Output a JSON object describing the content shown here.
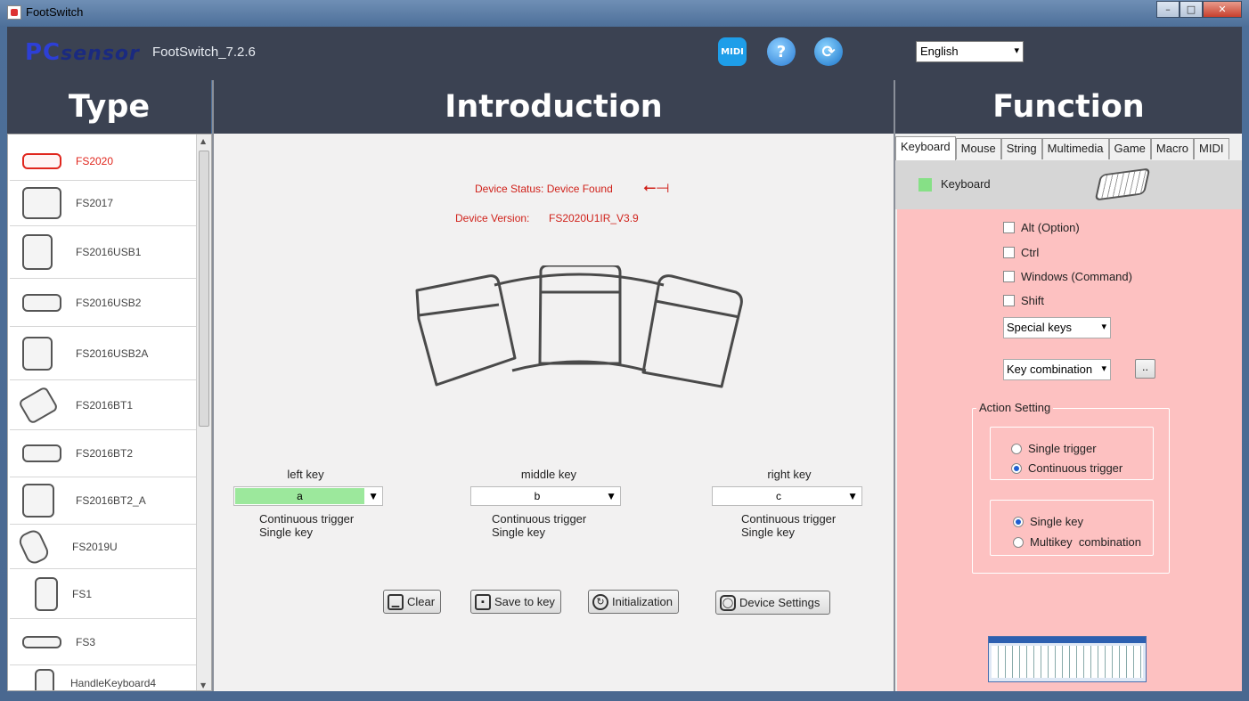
{
  "window": {
    "title": "FootSwitch",
    "controls": [
      "–",
      "□",
      "✕"
    ]
  },
  "header": {
    "logo_main": "PC",
    "logo_sub": "sensor",
    "version": "FootSwitch_7.2.6",
    "midi_label": "MIDI",
    "help_label": "?",
    "refresh_label": "⟳",
    "language": "English"
  },
  "columns": {
    "type": "Type",
    "introduction": "Introduction",
    "function": "Function"
  },
  "types": [
    {
      "label": "FS2020",
      "icon": "fs2020-icon",
      "selected": true
    },
    {
      "label": "FS2017",
      "icon": "fs2017-icon"
    },
    {
      "label": "FS2016USB1",
      "icon": "fs2016usb1-icon"
    },
    {
      "label": "FS2016USB2",
      "icon": "fs2016usb2-icon"
    },
    {
      "label": "FS2016USB2A",
      "icon": "fs2016usb2a-icon"
    },
    {
      "label": "FS2016BT1",
      "icon": "fs2016bt1-icon"
    },
    {
      "label": "FS2016BT2",
      "icon": "fs2016bt2-icon"
    },
    {
      "label": "FS2016BT2_A",
      "icon": "fs2016bt2a-icon"
    },
    {
      "label": "FS2019U",
      "icon": "fs2019u-icon"
    },
    {
      "label": "FS1",
      "icon": "fs1-icon"
    },
    {
      "label": "FS3",
      "icon": "fs3-icon"
    },
    {
      "label": "HandleKeyboard4",
      "icon": "handlekeyboard4-icon"
    }
  ],
  "intro": {
    "device_status": "Device Status: Device Found",
    "device_version_label": "Device Version:",
    "device_version_value": "FS2020U1IR_V3.9",
    "keys": [
      {
        "name": "left key",
        "value": "a",
        "line1": "Continuous trigger",
        "line2": "Single key"
      },
      {
        "name": "middle key",
        "value": "b",
        "line1": "Continuous trigger",
        "line2": "Single key"
      },
      {
        "name": "right key",
        "value": "c",
        "line1": "Continuous trigger",
        "line2": "Single key"
      }
    ],
    "buttons": {
      "clear": "Clear",
      "save": "Save to key",
      "init": "Initialization",
      "settings": "Device Settings"
    }
  },
  "function": {
    "tabs": [
      "Keyboard",
      "Mouse",
      "String",
      "Multimedia",
      "Game",
      "Macro",
      "MIDI"
    ],
    "active_tab": "Keyboard",
    "section_label": "Keyboard",
    "modifiers": [
      "Alt (Option)",
      "Ctrl",
      "Windows (Command)",
      "Shift"
    ],
    "special_keys": "Special keys",
    "key_combination": "Key combination",
    "more_button": "..",
    "action_setting": "Action Setting",
    "trigger": {
      "single": "Single trigger",
      "continuous": "Continuous trigger",
      "selected": "continuous"
    },
    "keymode": {
      "single": "Single key",
      "multi": "Multikey  combination",
      "selected": "single"
    }
  },
  "colors": {
    "header": "#3b4252",
    "accent_red": "#d0221b",
    "pink": "#fdc1c1",
    "green": "#9ce89c"
  }
}
